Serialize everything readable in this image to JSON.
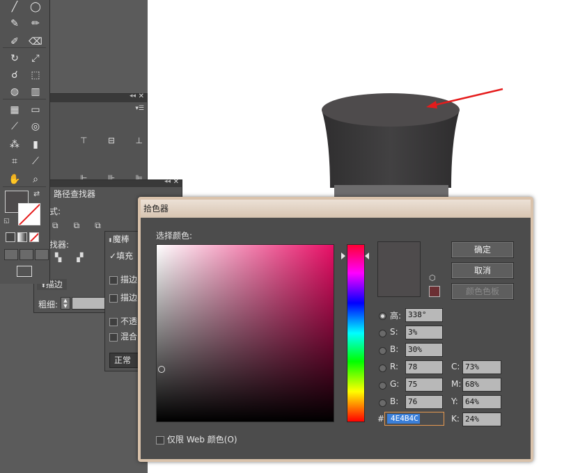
{
  "colors": {
    "current_color": "#4e4b4c",
    "previous_color": "#6b2f33",
    "panel": "#535353",
    "dialog": "#4c4c4c",
    "title_bar": "#dfcdbb",
    "field": "#b8b8b8",
    "hex_highlight": "#3b7fd9",
    "hat": "#3b3a3b",
    "arrow": "#e51c1c"
  },
  "toolbar": {
    "tools": [
      "line-icon",
      "ellipse-icon",
      "brush-icon",
      "pencil-icon",
      "blob-brush-icon",
      "eraser-icon",
      "rotate-icon",
      "scale-icon",
      "warp-icon",
      "free-transform-icon",
      "shape-builder-icon",
      "chart-icon",
      "mesh-icon",
      "gradient-icon",
      "eyedropper-icon",
      "blend-icon",
      "symbol-sprayer-icon",
      "column-graph-icon",
      "artboard-icon",
      "slice-icon",
      "hand-icon",
      "zoom-icon"
    ]
  },
  "panels": {
    "pathfinder_tab": "路径查找器",
    "shape_mode_label": "式:",
    "pathfinder_label": "找器:",
    "appearance_tab": "魔棒",
    "fill_label": "填充",
    "stroke_label_1": "描边",
    "stroke_label_2": "描边",
    "opacity_label": "不透",
    "blend_label": "混合",
    "blend_mode_value": "正常",
    "stroke_tab": "描边",
    "weight_label": "粗细:"
  },
  "dialog": {
    "title": "拾色器",
    "select_color_label": "选择颜色:",
    "ok_button": "确定",
    "cancel_button": "取消",
    "swatches_button": "颜色色板",
    "web_only_label": "仅限 Web 颜色(O)",
    "hsb": {
      "h_label": "高:",
      "h_value": "338°",
      "s_label": "S:",
      "s_value": "3%",
      "b_label": "B:",
      "b_value": "30%"
    },
    "rgb": {
      "r_label": "R:",
      "r_value": "78",
      "g_label": "G:",
      "g_value": "75",
      "b_label": "B:",
      "b_value": "76"
    },
    "cmyk": {
      "c_label": "C:",
      "c_value": "73%",
      "m_label": "M:",
      "m_value": "68%",
      "y_label": "Y:",
      "y_value": "64%",
      "k_label": "K:",
      "k_value": "24%"
    },
    "hex_label": "#",
    "hex_value": "4E4B4C"
  }
}
